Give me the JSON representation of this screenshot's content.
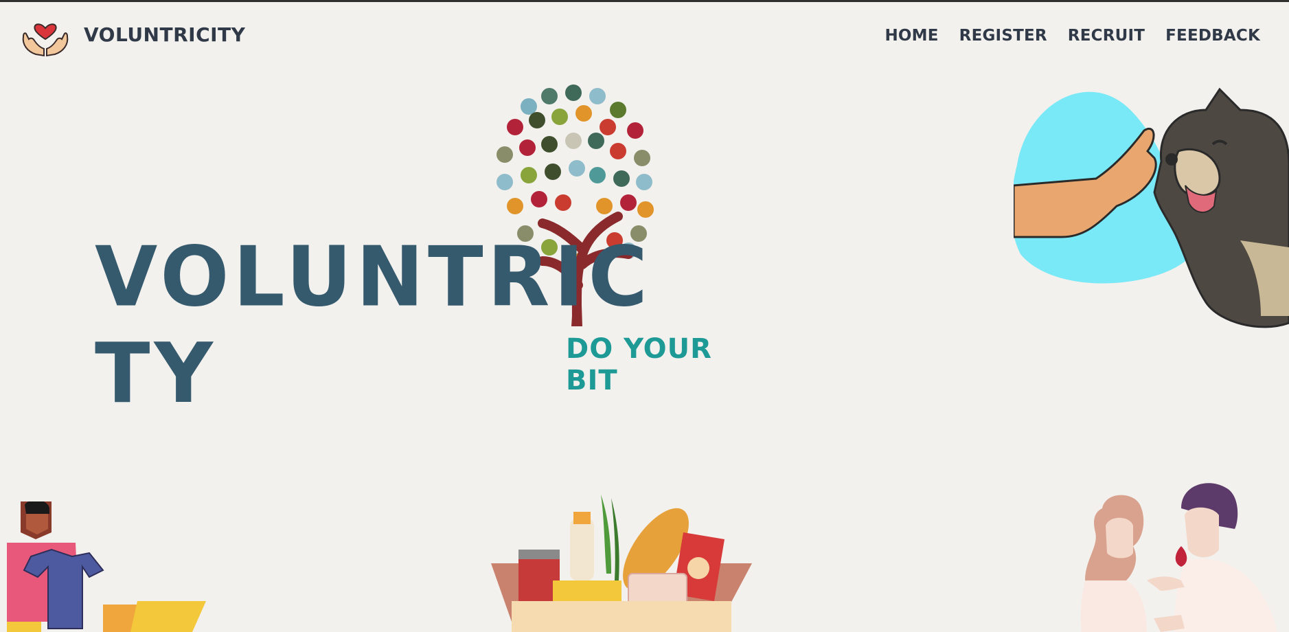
{
  "navbar": {
    "brand_name": "VOLUNTRICITY",
    "logo_icon": "hands-heart-icon",
    "links": [
      {
        "label": "HOME"
      },
      {
        "label": "REGISTER"
      },
      {
        "label": "RECRUIT"
      },
      {
        "label": "FEEDBACK"
      }
    ]
  },
  "hero": {
    "title_part1": "VOLUNTRIC",
    "title_part2": "TY",
    "tagline": "DO YOUR BIT",
    "tree_icon": "hand-tree-icon"
  },
  "illustrations": {
    "dog": "dog-paw-illustration",
    "clothes": "clothes-donation-illustration",
    "food": "food-box-illustration",
    "blood": "blood-donation-illustration"
  },
  "colors": {
    "background": "#f3f1ed",
    "nav_text": "#2f3947",
    "title": "#355a6e",
    "tagline": "#1d9a96",
    "heart": "#d9353b",
    "dog_bg": "#79e8f7"
  }
}
